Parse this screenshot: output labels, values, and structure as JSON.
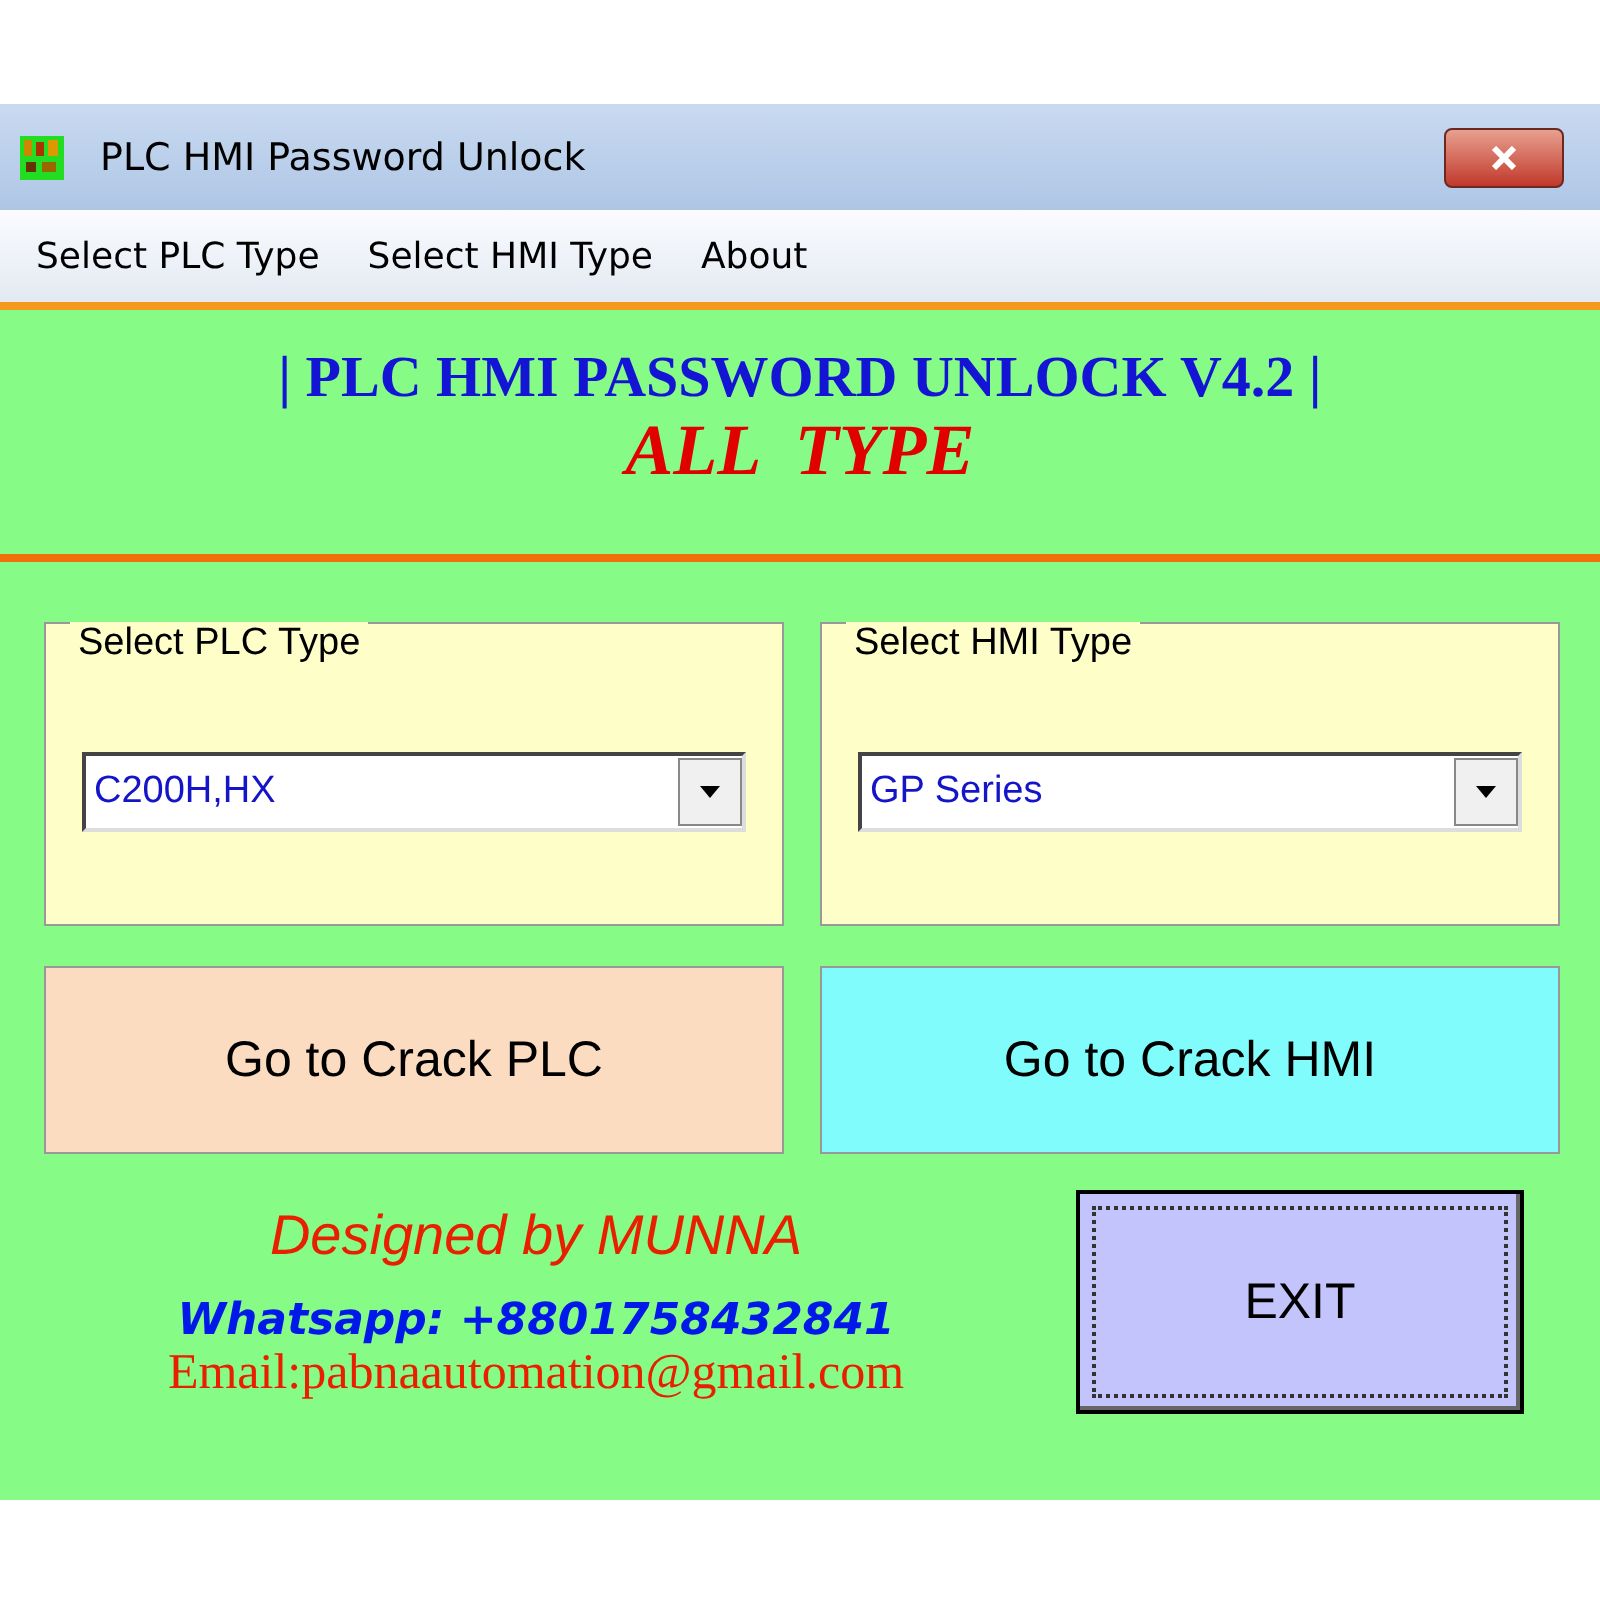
{
  "window": {
    "title": "PLC HMI Password Unlock"
  },
  "menu": [
    "Select PLC Type",
    "Select HMI Type",
    "About"
  ],
  "header": {
    "title": "| PLC HMI PASSWORD UNLOCK V4.2 |",
    "subtitle": "ALL  TYPE"
  },
  "groups": [
    {
      "label": "Select PLC Type",
      "value": "C200H,HX"
    },
    {
      "label": "Select HMI Type",
      "value": "GP Series"
    }
  ],
  "crack_buttons": [
    {
      "label": "Go to Crack PLC",
      "color": "#fcdcc0"
    },
    {
      "label": "Go to Crack HMI",
      "color": "#80fcfc"
    }
  ],
  "credits": {
    "designer": "Designed by MUNNA",
    "whatsapp": "Whatsapp: +8801758432841",
    "email": "Email:pabnaautomation@gmail.com"
  },
  "exit_button": "EXIT"
}
